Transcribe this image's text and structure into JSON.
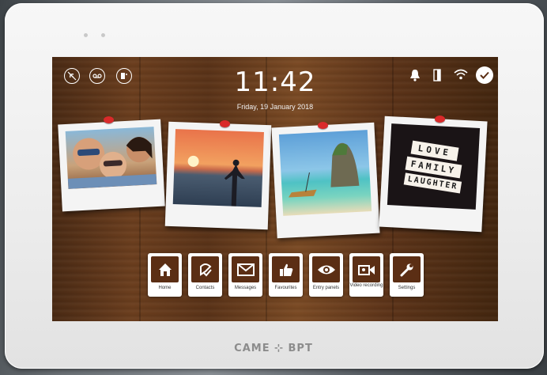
{
  "brand": "CAME ⊹ BPT",
  "status_bar": {
    "left_icons": [
      "do-not-disturb-icon",
      "voicemail-icon",
      "door-status-icon"
    ],
    "right_icons": [
      "bell-icon",
      "door-icon",
      "wifi-icon",
      "check-icon"
    ]
  },
  "clock": {
    "time": "11:42",
    "date": "Friday, 19 January 2018"
  },
  "photos": [
    {
      "subject": "family-selfie"
    },
    {
      "subject": "sunset-sea"
    },
    {
      "subject": "tropical-beach-boat"
    },
    {
      "subject": "lightbox-sign",
      "text": [
        "LOVE",
        "FAMILY",
        "LAUGHTER"
      ]
    }
  ],
  "menu": [
    {
      "label": "Home",
      "icon": "home-icon"
    },
    {
      "label": "Contacts",
      "icon": "contacts-icon"
    },
    {
      "label": "Messages",
      "icon": "envelope-icon"
    },
    {
      "label": "Favourites",
      "icon": "thumbs-up-icon"
    },
    {
      "label": "Entry panels",
      "icon": "eye-icon"
    },
    {
      "label": "Video recording",
      "icon": "video-camera-icon"
    },
    {
      "label": "Settings",
      "icon": "wrench-icon"
    }
  ],
  "colors": {
    "pin": "#d92a2a",
    "menu_icon_bg": "#5b2e14",
    "wood": "#6b3e1e"
  }
}
